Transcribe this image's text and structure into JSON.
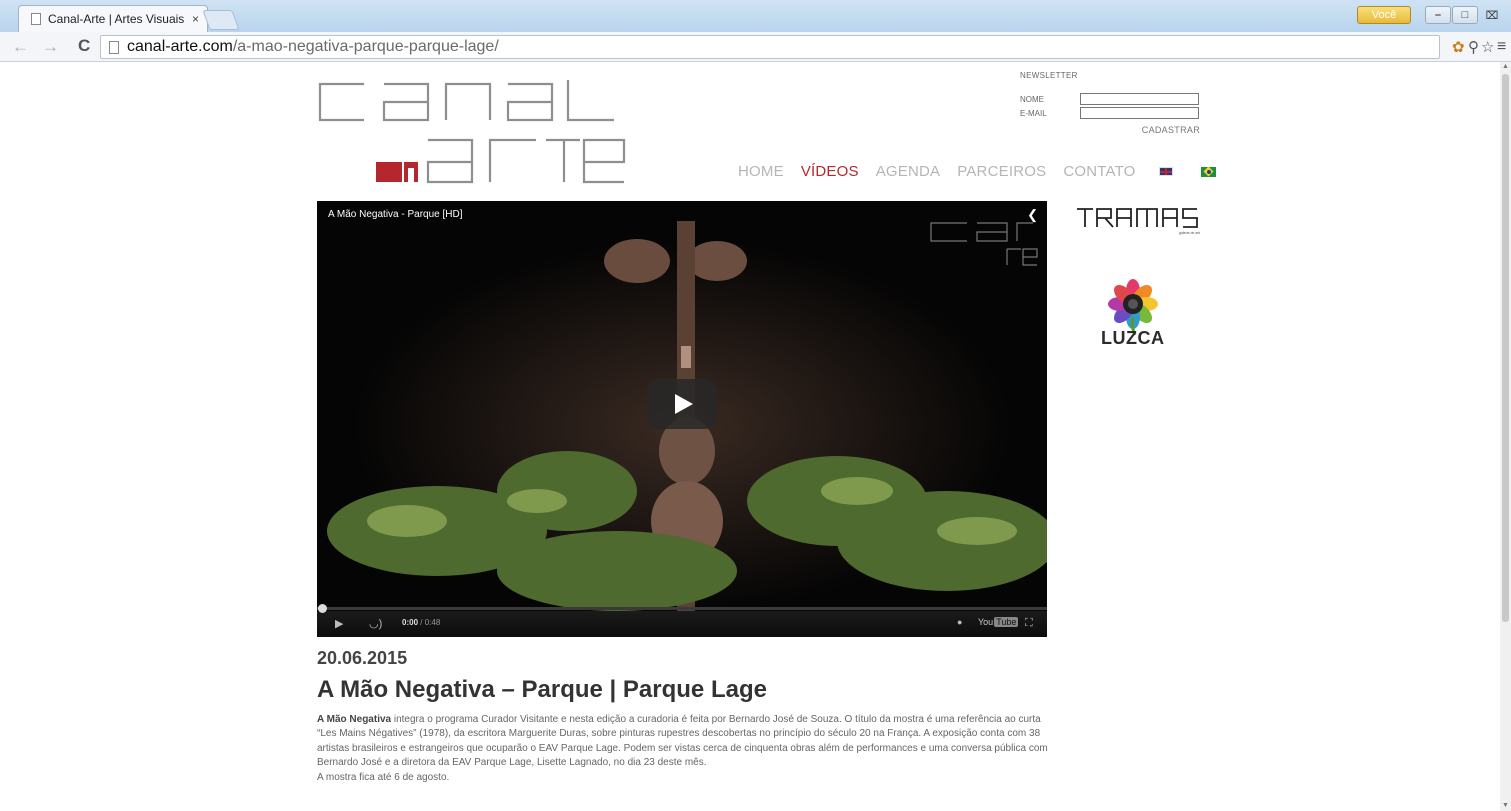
{
  "browser": {
    "tab_title": "Canal-Arte | Artes Visuais",
    "tab_close": "×",
    "profile_label": "Você",
    "url_host": "canal-arte.com",
    "url_path": "/a-mao-negativa-parque-parque-lage/",
    "icons": [
      "back-icon",
      "forward-icon",
      "reload-icon",
      "page-icon",
      "extension-icon",
      "zoom-icon",
      "bookmark-star-icon",
      "menu-icon"
    ]
  },
  "newsletter": {
    "title": "NEWSLETTER",
    "name_label": "NOME",
    "email_label": "E-MAIL",
    "submit_label": "CADASTRAR"
  },
  "nav": {
    "home": "HOME",
    "videos": "VÍDEOS",
    "agenda": "AGENDA",
    "parceiros": "PARCEIROS",
    "contato": "CONTATO"
  },
  "video": {
    "title": "A Mão Negativa - Parque [HD]",
    "time_current": "0:00",
    "time_total": "/ 0:48",
    "youtube_label": "You",
    "youtube_badge": "Tube"
  },
  "sidebar": {
    "partner_2": "LUZCA"
  },
  "article": {
    "date": "20.06.2015",
    "headline": "A Mão Negativa – Parque | Parque Lage",
    "lead_bold": "A Mão Negativa",
    "body_rest": " integra o programa Curador Visitante e nesta edição a curadoria é feita por Bernardo José de Souza. O título da mostra é uma referência ao curta “Les Mains Négatives” (1978), da escritora Marguerite Duras, sobre pinturas rupestres descobertas no princípio do século 20 na França. A exposição conta com 38 artistas brasileiros e estrangeiros que ocuparão o EAV Parque Lage. Podem ser vistas cerca de cinquenta obras além de performances e uma conversa pública com Bernardo José e a diretora da EAV Parque Lage, Lisette Lagnado, no dia 23 deste mês.",
    "closing": "A mostra fica até 6 de agosto."
  },
  "colors": {
    "accent": "#b5262e",
    "nav_inactive": "#b5b5b5",
    "text": "#666666"
  }
}
